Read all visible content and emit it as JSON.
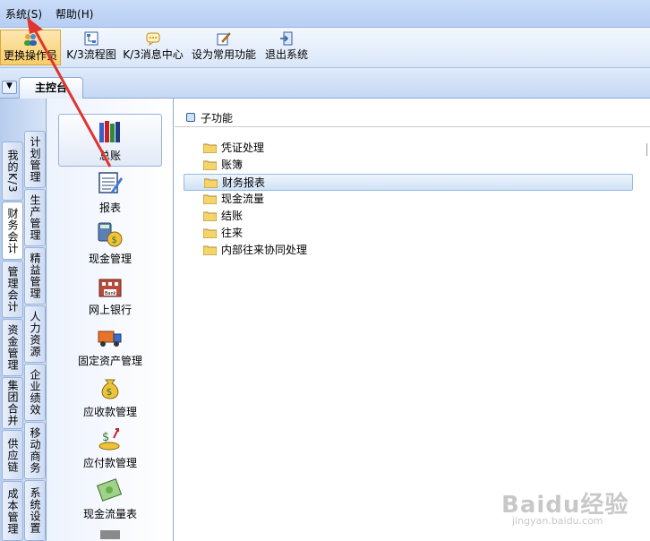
{
  "menu": {
    "system": "系统",
    "system_key": "(S)",
    "help": "帮助",
    "help_key": "(H)"
  },
  "toolbar": {
    "switch_operator": "更换操作员",
    "k3_flowchart": "K/3流程图",
    "k3_message_center": "K/3消息中心",
    "set_common": "设为常用功能",
    "exit_system": "退出系统"
  },
  "tabs": {
    "main": "主控台"
  },
  "left_nav": {
    "outer": [
      "我的K/3",
      "财务会计",
      "管理会计",
      "资金管理",
      "集团合并",
      "供应链",
      "成本管理"
    ],
    "inner": [
      "计划管理",
      "生产管理",
      "精益管理",
      "人力资源",
      "企业绩效",
      "移动商务",
      "系统设置"
    ]
  },
  "modules": [
    {
      "label": "总账"
    },
    {
      "label": "报表"
    },
    {
      "label": "现金管理"
    },
    {
      "label": "网上银行"
    },
    {
      "label": "固定资产管理"
    },
    {
      "label": "应收款管理"
    },
    {
      "label": "应付款管理"
    },
    {
      "label": "现金流量表"
    }
  ],
  "icon_text": {
    "bank": "Bank"
  },
  "content": {
    "header": "子功能",
    "items": [
      "凭证处理",
      "账簿",
      "财务报表",
      "现金流量",
      "结账",
      "往来",
      "内部往来协同处理"
    ]
  },
  "watermark": {
    "logo": "Baidu经验",
    "url": "jingyan.baidu.com"
  },
  "colors": {
    "accent_red": "#e0342e",
    "selection_blue": "#cfe2f6",
    "folder_yellow": "#f5d56b"
  }
}
